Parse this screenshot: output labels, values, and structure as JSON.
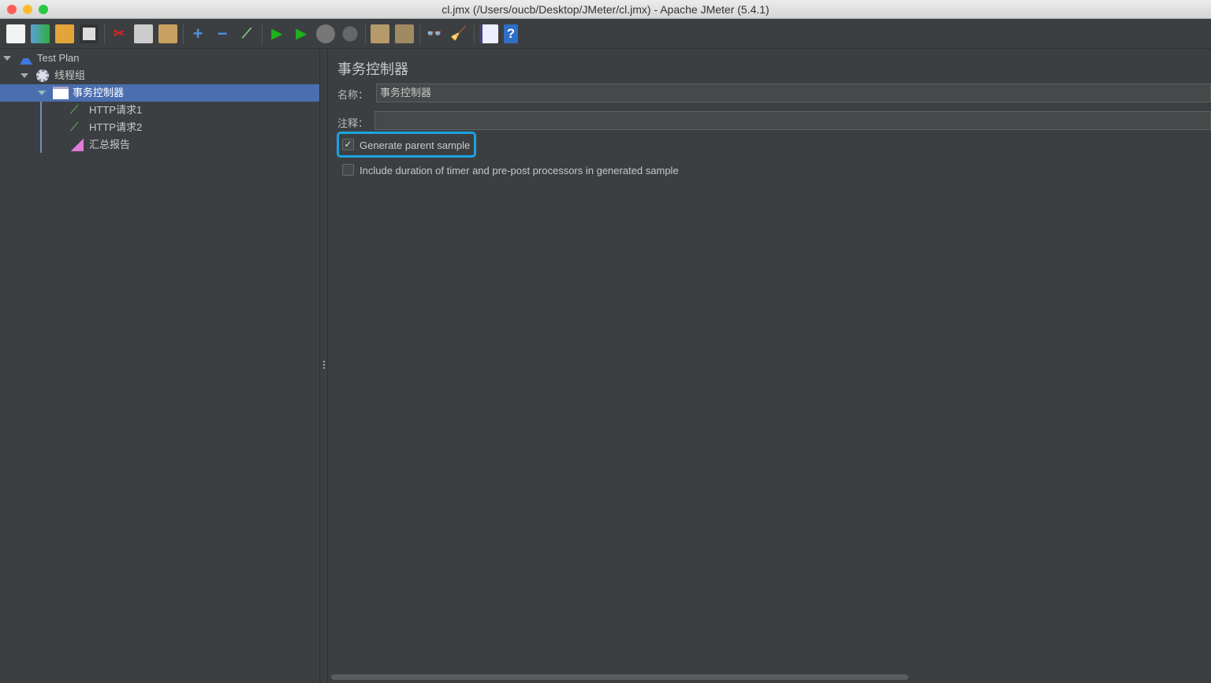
{
  "window": {
    "title": "cl.jmx (/Users/oucb/Desktop/JMeter/cl.jmx) - Apache JMeter (5.4.1)"
  },
  "toolbar": {
    "icons": [
      "new-icon",
      "templates-icon",
      "open-icon",
      "save-icon",
      "cut-icon",
      "copy-icon",
      "paste-icon",
      "expand-icon",
      "collapse-icon",
      "toggle-icon",
      "start-icon",
      "start-no-pause-icon",
      "stop-icon",
      "shutdown-icon",
      "clear-icon",
      "clear-all-icon",
      "search-icon",
      "reset-search-icon",
      "function-helper-icon",
      "help-icon"
    ]
  },
  "tree": {
    "items": [
      {
        "label": "Test Plan"
      },
      {
        "label": "线程组"
      },
      {
        "label": "事务控制器"
      },
      {
        "label": "HTTP请求1"
      },
      {
        "label": "HTTP请求2"
      },
      {
        "label": "汇总报告"
      }
    ]
  },
  "panel": {
    "title": "事务控制器",
    "name_label": "名称：",
    "name_value": "事务控制器",
    "comment_label": "注释：",
    "comment_value": "",
    "generate_parent_label": "Generate parent sample",
    "generate_parent_checked": true,
    "include_duration_label": "Include duration of timer and pre-post processors in generated sample",
    "include_duration_checked": false
  },
  "colors": {
    "background": "#3c3f41",
    "selection": "#4b6eaf",
    "highlight": "#1aa3e0"
  }
}
